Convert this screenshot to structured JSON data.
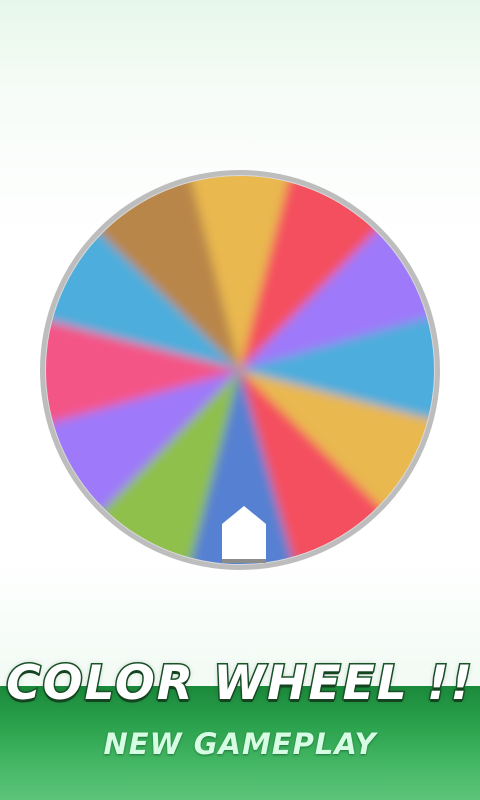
{
  "title": "COLOR WHEEL !!",
  "subtitle": "NEW GAMEPLAY",
  "wheel": {
    "segments": [
      {
        "name": "orange",
        "color": "#E9B84F"
      },
      {
        "name": "red",
        "color": "#F4505F"
      },
      {
        "name": "purple",
        "color": "#9E79FA"
      },
      {
        "name": "blue",
        "color": "#4DADDC"
      },
      {
        "name": "orange",
        "color": "#E9B84F"
      },
      {
        "name": "red",
        "color": "#F4505F"
      },
      {
        "name": "navy-blue",
        "color": "#5680D2"
      },
      {
        "name": "green",
        "color": "#8FC04C"
      },
      {
        "name": "purple",
        "color": "#9E79FA"
      },
      {
        "name": "pink",
        "color": "#F45487"
      },
      {
        "name": "blue",
        "color": "#4DADDC"
      },
      {
        "name": "brown",
        "color": "#B9864A"
      }
    ],
    "rim_color": "#BDBDBD"
  },
  "pointer": {
    "color": "#FFFFFF",
    "base_color": "#8C8C8C"
  },
  "banner": {
    "color": "#2BA24D"
  }
}
